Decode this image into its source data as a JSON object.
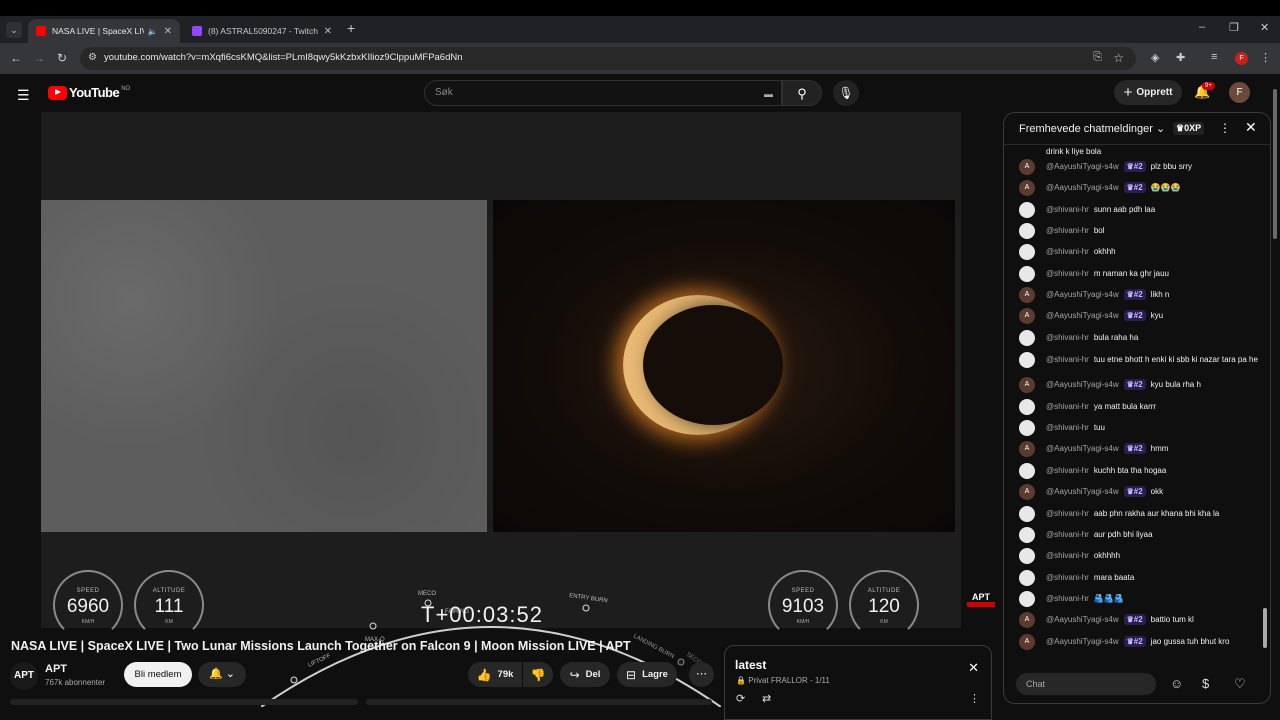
{
  "browser": {
    "tabs": [
      {
        "title": "NASA LIVE | SpaceX LIVE | T",
        "active": true,
        "favicon_color": "#ff0000"
      },
      {
        "title": "(8) ASTRAL5090247 - Twitch",
        "active": false,
        "favicon_color": "#9146ff"
      }
    ],
    "url": "youtube.com/watch?v=mXqfi6csKMQ&list=PLmI8qwy5kKzbxKIlioz9ClppuMFPa6dNn",
    "profile_initial": "F"
  },
  "yt": {
    "logo_text": "YouTube",
    "country_code": "NO",
    "search_placeholder": "Søk",
    "create_label": "Opprett",
    "notification_count": "9+",
    "avatar_initial": "F"
  },
  "video": {
    "gauges": [
      {
        "label": "SPEED",
        "value": "6960",
        "unit": "KM/H"
      },
      {
        "label": "ALTITUDE",
        "value": "111",
        "unit": "KM"
      },
      {
        "label": "SPEED",
        "value": "9103",
        "unit": "KM/H"
      },
      {
        "label": "ALTITUDE",
        "value": "120",
        "unit": "KM"
      }
    ],
    "timeline_events": [
      "LIFTOFF",
      "MAX-Q",
      "MECO",
      "FAIRING",
      "ENTRY BURN",
      "LANDING BURN",
      "SECO-1"
    ],
    "timer": "T+00:03:52",
    "channel_logo": "APT"
  },
  "meta": {
    "title": "NASA LIVE | SpaceX LIVE | Two Lunar Missions Launch Together on Falcon 9 | Moon Mission LIVE | APT",
    "channel_name": "APT",
    "channel_avatar": "APT",
    "subscribers": "767k abonnenter",
    "join_label": "Bli medlem",
    "likes": "79k",
    "share_label": "Del",
    "save_label": "Lagre"
  },
  "playlist": {
    "title": "latest",
    "subtitle": "Privat FRALLOR - 1/11"
  },
  "chat": {
    "header_title": "Fremhevede chatmeldinger",
    "xp_label": "0XP",
    "first_line": "drink k liye bola",
    "messages": [
      {
        "author": "@AayushiTyagi-s4w",
        "badge": "#2",
        "text": "plz bbu srry",
        "avatar": "A",
        "type": "a"
      },
      {
        "author": "@AayushiTyagi-s4w",
        "badge": "#2",
        "text": "😭😭😭",
        "avatar": "A",
        "type": "a"
      },
      {
        "author": "@shivani-hr",
        "badge": "",
        "text": "sunn aab pdh laa",
        "avatar": "",
        "type": "s"
      },
      {
        "author": "@shivani-hr",
        "badge": "",
        "text": "bol",
        "avatar": "",
        "type": "s"
      },
      {
        "author": "@shivani-hr",
        "badge": "",
        "text": "okhhh",
        "avatar": "",
        "type": "s"
      },
      {
        "author": "@shivani-hr",
        "badge": "",
        "text": "m naman ka ghr jauu",
        "avatar": "",
        "type": "s"
      },
      {
        "author": "@AayushiTyagi-s4w",
        "badge": "#2",
        "text": "likh n",
        "avatar": "A",
        "type": "a"
      },
      {
        "author": "@AayushiTyagi-s4w",
        "badge": "#2",
        "text": "kyu",
        "avatar": "A",
        "type": "a"
      },
      {
        "author": "@shivani-hr",
        "badge": "",
        "text": "bula raha ha",
        "avatar": "",
        "type": "s"
      },
      {
        "author": "@shivani-hr",
        "badge": "",
        "text": "tuu etne bhott h enki ki sbb ki nazar tara pa he",
        "avatar": "",
        "type": "s"
      },
      {
        "author": "@AayushiTyagi-s4w",
        "badge": "#2",
        "text": "kyu bula rha h",
        "avatar": "A",
        "type": "a"
      },
      {
        "author": "@shivani-hr",
        "badge": "",
        "text": "ya matt bula karrr",
        "avatar": "",
        "type": "s"
      },
      {
        "author": "@shivani-hr",
        "badge": "",
        "text": "tuu",
        "avatar": "",
        "type": "s"
      },
      {
        "author": "@AayushiTyagi-s4w",
        "badge": "#2",
        "text": "hmm",
        "avatar": "A",
        "type": "a"
      },
      {
        "author": "@shivani-hr",
        "badge": "",
        "text": "kuchh bta tha hogaa",
        "avatar": "",
        "type": "s"
      },
      {
        "author": "@AayushiTyagi-s4w",
        "badge": "#2",
        "text": "okk",
        "avatar": "A",
        "type": "a"
      },
      {
        "author": "@shivani-hr",
        "badge": "",
        "text": "aab phn rakha aur khana bhi kha la",
        "avatar": "",
        "type": "s"
      },
      {
        "author": "@shivani-hr",
        "badge": "",
        "text": "aur pdh bhi liyaa",
        "avatar": "",
        "type": "s"
      },
      {
        "author": "@shivani-hr",
        "badge": "",
        "text": "okhhhh",
        "avatar": "",
        "type": "s"
      },
      {
        "author": "@shivani-hr",
        "badge": "",
        "text": "mara baata",
        "avatar": "",
        "type": "s"
      },
      {
        "author": "@shivani-hr",
        "badge": "",
        "text": "🫂🫂🫂",
        "avatar": "",
        "type": "s"
      },
      {
        "author": "@AayushiTyagi-s4w",
        "badge": "#2",
        "text": "battio tum kl",
        "avatar": "A",
        "type": "a"
      },
      {
        "author": "@AayushiTyagi-s4w",
        "badge": "#2",
        "text": "jao gussa tuh bhut kro",
        "avatar": "A",
        "type": "a"
      }
    ],
    "input_placeholder": "Chat"
  }
}
